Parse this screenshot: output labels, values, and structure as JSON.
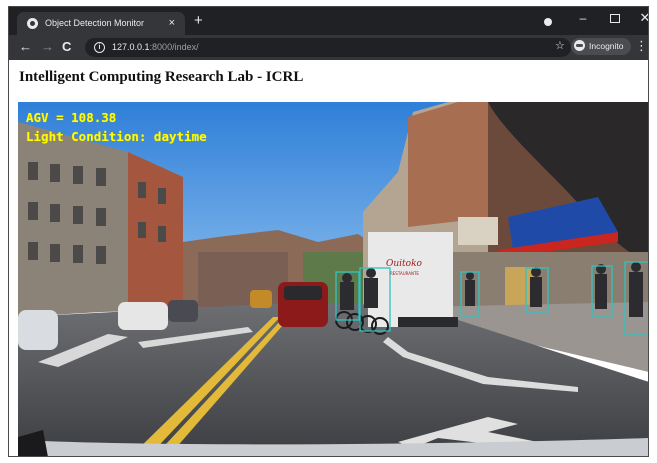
{
  "browser": {
    "tab_title": "Object Detection Monitor",
    "tab_close": "×",
    "new_tab": "+",
    "url_host": "127.0.0.1",
    "url_rest": ":8000/index/",
    "incognito_label": "Incognito",
    "nav_back": "←",
    "nav_forward": "→",
    "nav_reload": "C",
    "star": "☆",
    "menu": "⋮",
    "win_min": "–",
    "win_close": "✕",
    "info_glyph": "i"
  },
  "page": {
    "title": "Intelligent Computing Research Lab - ICRL"
  },
  "video": {
    "agv_text": "AGV = 108.38",
    "light_text": "Light Condition: daytime",
    "overlay_color": "#ffff00",
    "box_color": "#2fc4c0"
  },
  "truck": {
    "logo": "Ouitoko",
    "sub": "RESTAURANTE"
  },
  "icons": [
    "chrome-favicon",
    "close-icon",
    "new-tab-icon",
    "back-icon",
    "forward-icon",
    "reload-icon",
    "info-icon",
    "star-icon",
    "incognito-icon",
    "menu-icon"
  ]
}
